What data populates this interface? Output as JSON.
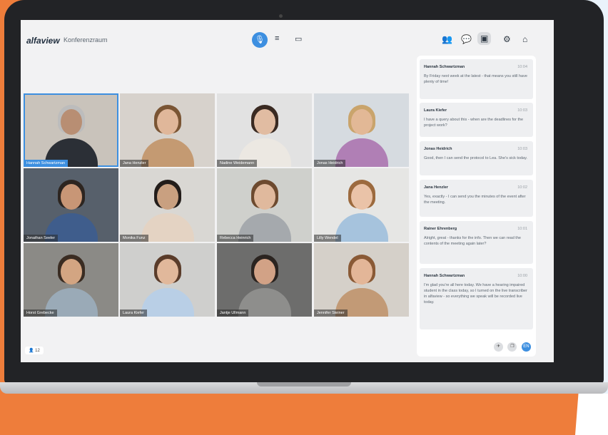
{
  "app": {
    "logo": "alfaview",
    "room": "Konferenzraum"
  },
  "toolbar": {
    "mic_icon": "🎙",
    "notes_icon": "≡",
    "screen_icon": "▭",
    "participants_icon": "👥",
    "chat_icon": "💬",
    "panel_icon": "▣",
    "settings_icon": "⚙",
    "home_icon": "⌂"
  },
  "participants": [
    {
      "name": "Hannah Schwartzman",
      "bg": "#c9c3bb",
      "skin": "#b88e73",
      "hair": "#bcbcbc",
      "shirt": "#2b2f36",
      "selected": true
    },
    {
      "name": "Jana Henzler",
      "bg": "#d7d2cc",
      "skin": "#e0b79a",
      "hair": "#7a5534",
      "shirt": "#c49a72"
    },
    {
      "name": "Nadine Weidemann",
      "bg": "#e2e2e2",
      "skin": "#e1bca2",
      "hair": "#3a2a22",
      "shirt": "#ece8e2"
    },
    {
      "name": "Jonas Heidrich",
      "bg": "#d6dbe0",
      "skin": "#e2b896",
      "hair": "#c9a46c",
      "shirt": "#b07fb5"
    },
    {
      "name": "Jonathan Seeler",
      "bg": "#57606b",
      "skin": "#c89676",
      "hair": "#2d2520",
      "shirt": "#3f5d8c"
    },
    {
      "name": "Monika Funz",
      "bg": "#d9d7d3",
      "skin": "#c9a080",
      "hair": "#231d1a",
      "shirt": "#e4d3c3"
    },
    {
      "name": "Rebecca Heinrich",
      "bg": "#cfd0cc",
      "skin": "#e0b99d",
      "hair": "#6d4a2f",
      "shirt": "#a5a9ad"
    },
    {
      "name": "Lilly Wendel",
      "bg": "#e6e6e4",
      "skin": "#eac3a8",
      "hair": "#9c6a3e",
      "shirt": "#a6c3dd"
    },
    {
      "name": "Horst Grebecke",
      "bg": "#8b8a86",
      "skin": "#d3a582",
      "hair": "#3a2c22",
      "shirt": "#9aaab7"
    },
    {
      "name": "Laura Kiefer",
      "bg": "#cfcfcd",
      "skin": "#e1b89b",
      "hair": "#5a3c2a",
      "shirt": "#b9cfe6"
    },
    {
      "name": "Jantje Ullmann",
      "bg": "#6d6d6c",
      "skin": "#d2a286",
      "hair": "#2b2420",
      "shirt": "#8e8e8c"
    },
    {
      "name": "Jennifer Steiner",
      "bg": "#d5d0c9",
      "skin": "#e3b698",
      "hair": "#8a5a36",
      "shirt": "#c29a76"
    }
  ],
  "chat": {
    "messages": [
      {
        "author": "Hannah Schwartzman",
        "time": "10:04",
        "text": "By Friday next week at the latest - that means you still have plenty of time!"
      },
      {
        "author": "Laura Kiefer",
        "time": "10:03",
        "text": "I have a query about this - when are the deadlines for the project work?"
      },
      {
        "author": "Jonas Heidrich",
        "time": "10:03",
        "text": "Good, then I can send the protocol to Lea. She's sick today."
      },
      {
        "author": "Jana Henzler",
        "time": "10:02",
        "text": "Yes, exactly - I can send you the minutes of the event after the meeting."
      },
      {
        "author": "Rainer Ehrenberg",
        "time": "10:01",
        "text": "Alright, great - thanks for the info. Then we can read the contents of the meeting again later?"
      },
      {
        "author": "Hannah Schwartzman",
        "time": "10:00",
        "text": "I'm glad you're all here today. We have a hearing impaired student in the class today, so I turned on the live transcriber in alfaview - so everything we speak will be recorded live today."
      }
    ],
    "buttons": {
      "pin": "✈",
      "copy": "❐",
      "language": "EN"
    }
  },
  "participant_count": "12",
  "count_icon": "👤"
}
